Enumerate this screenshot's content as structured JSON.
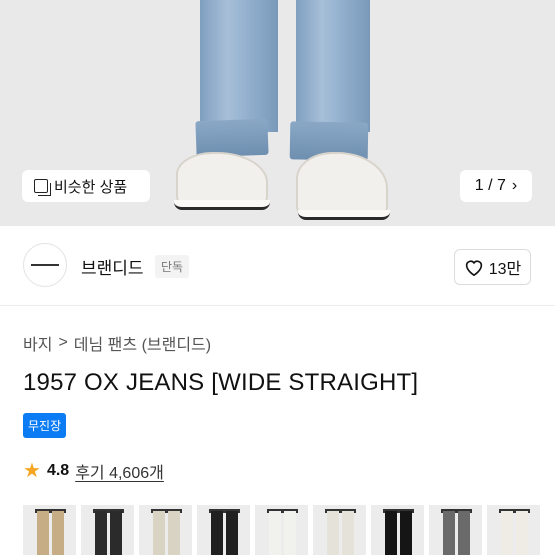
{
  "hero": {
    "similar_label": "비슷한 상품",
    "pager_text": "1 / 7",
    "pager_chevron": "›"
  },
  "brand": {
    "name": "브랜디드",
    "exclusive_label": "단독",
    "like_count": "13만"
  },
  "breadcrumb": {
    "category": "바지",
    "separator": ">",
    "subcategory": "데님 팬츠 (브랜디드)"
  },
  "product": {
    "title": "1957 OX JEANS [WIDE STRAIGHT]",
    "badge": "무진장",
    "rating": "4.8",
    "reviews": "후기 4,606개"
  },
  "thumbnails": {
    "colors": [
      "#c6ad86",
      "#2b2b2b",
      "#d9d3c4",
      "#202020",
      "#f1f1ee",
      "#e5e2da",
      "#151515",
      "#6a6a6a",
      "#efece6"
    ]
  },
  "icons": {
    "similar": "copy-square-icon",
    "heart": "heart-outline-icon",
    "star": "star-filled-icon",
    "chevron": "chevron-right-icon"
  }
}
